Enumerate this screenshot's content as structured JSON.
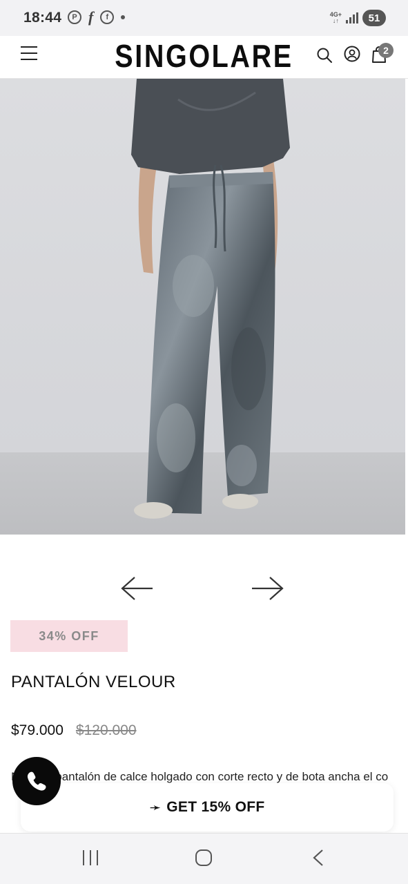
{
  "status_bar": {
    "time": "18:44",
    "network": "4G+",
    "battery": "51",
    "icons": [
      "pinterest-icon",
      "facebook-f-icon",
      "facebook-messenger-icon",
      "notification-dot-icon"
    ]
  },
  "header": {
    "brand": "SINGOLARE",
    "cart_count": "2",
    "icons": [
      "menu-icon",
      "search-icon",
      "account-icon",
      "cart-bag-icon"
    ]
  },
  "product": {
    "image_alt": "Model wearing grey crushed velvet wide-leg trousers with a dark satin top",
    "discount": "34% OFF",
    "title": "PANTALÓN VELOUR",
    "price": "$79.000",
    "old_price": "$120.000",
    "description": "Nuestro pantalón de calce holgado con corte recto y de bota ancha el co"
  },
  "promo": {
    "arrow": "➛",
    "text": "GET 15% OFF"
  },
  "colors": {
    "accent_badge": "#f8dde3",
    "brand_text": "#0d0d0d",
    "whatsapp_bg": "#0a0a0a"
  }
}
